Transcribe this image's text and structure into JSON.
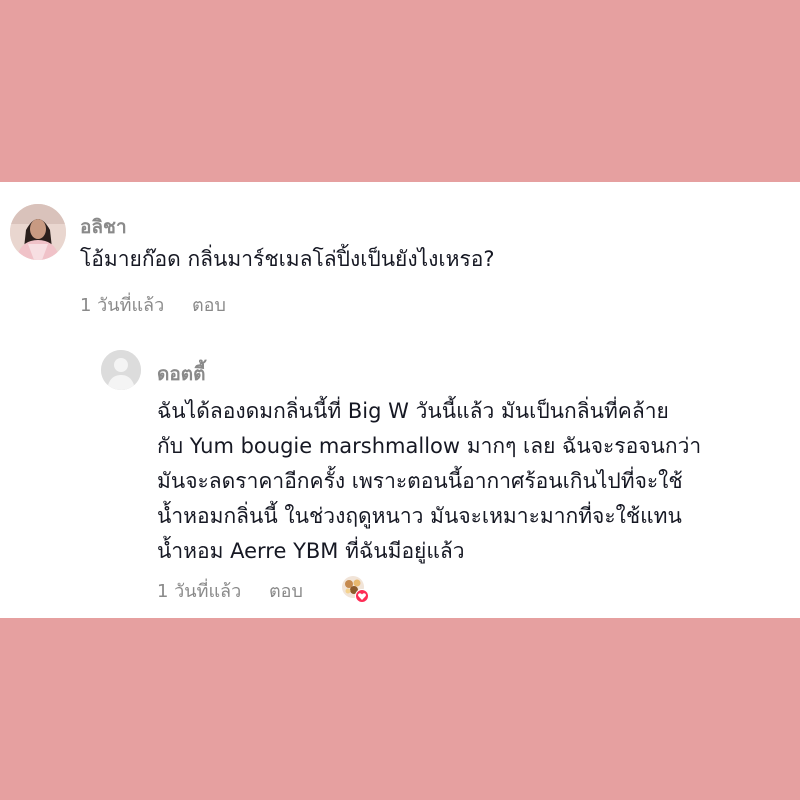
{
  "comments": [
    {
      "username": "อลิชา",
      "text": "โอ้มายก๊อด กลิ่นมาร์ชเมลโล่ปิ้งเป็นยังไงเหรอ?",
      "time": "1 วันที่แล้ว",
      "reply_label": "ตอบ"
    }
  ],
  "reply": {
    "username": "ดอตตี้",
    "text_lines": [
      "ฉันได้ลองดมกลิ่นนี้ที่ Big W วันนี้แล้ว มันเป็นกลิ่นที่คล้าย",
      "กับ Yum bougie marshmallow มากๆ เลย ฉันจะรอจนกว่า",
      "มันจะลดราคาอีกครั้ง เพราะตอนนี้อากาศร้อนเกินไปที่จะใช้",
      "น้ำหอมกลิ่นนี้ ในช่วงฤดูหนาว มันจะเหมาะมากที่จะใช้แทน",
      "น้ำหอม Aerre YBM ที่ฉันมีอยู่แล้ว"
    ],
    "time": "1 วันที่แล้ว",
    "reply_label": "ตอบ"
  },
  "colors": {
    "background": "#e6a0a0",
    "card": "#ffffff",
    "username": "#8a8a8a",
    "text": "#161823",
    "like_badge": "#fe2c55"
  },
  "icons": {
    "avatar_1": "user-photo-avatar",
    "avatar_2": "default-avatar-icon",
    "liked_by_creator": "creator-liked-heart-icon"
  }
}
